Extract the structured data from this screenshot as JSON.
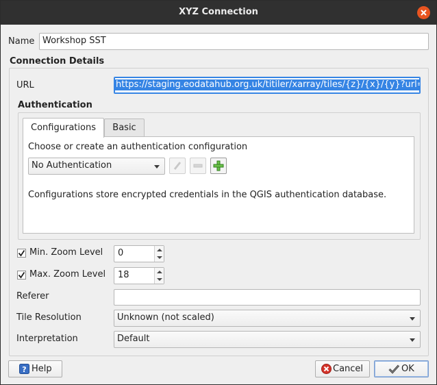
{
  "window": {
    "title": "XYZ Connection"
  },
  "name": {
    "label": "Name",
    "value": "Workshop SST"
  },
  "connection": {
    "heading": "Connection Details",
    "url_label": "URL",
    "url_value": "https://staging.eodatahub.org.uk/titiler/xarray/tiles/{z}/{x}/{y}?url="
  },
  "auth": {
    "heading": "Authentication",
    "tabs": [
      {
        "label": "Configurations",
        "selected": true
      },
      {
        "label": "Basic",
        "selected": false
      }
    ],
    "prompt": "Choose or create an authentication configuration",
    "config_selected": "No Authentication",
    "info": "Configurations store encrypted credentials in the QGIS authentication database."
  },
  "zoom": {
    "min": {
      "label": "Min. Zoom Level",
      "checked": true,
      "value": "0"
    },
    "max": {
      "label": "Max. Zoom Level",
      "checked": true,
      "value": "18"
    }
  },
  "referer": {
    "label": "Referer",
    "value": ""
  },
  "tile_resolution": {
    "label": "Tile Resolution",
    "selected": "Unknown (not scaled)"
  },
  "interpretation": {
    "label": "Interpretation",
    "selected": "Default"
  },
  "buttons": {
    "help": "Help",
    "cancel": "Cancel",
    "ok": "OK"
  },
  "colors": {
    "accent": "#3584e4",
    "close": "#e95420",
    "titlebar": "#303030"
  }
}
